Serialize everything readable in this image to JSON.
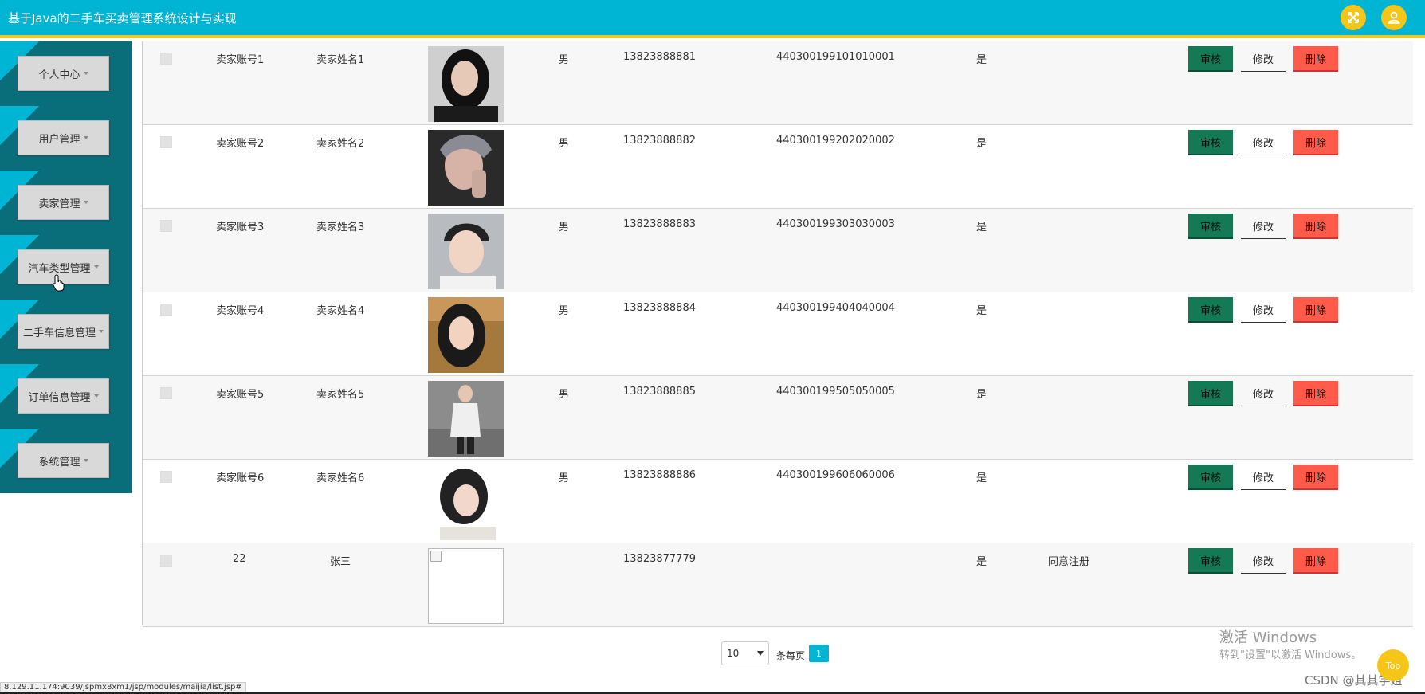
{
  "header": {
    "title": "基于Java的二手车买卖管理系统设计与实现",
    "icons": [
      "fullscreen-icon",
      "user-icon"
    ],
    "accent": "#00b4d4",
    "highlight": "#f5c518"
  },
  "sidebar": {
    "items": [
      {
        "label": "个人中心"
      },
      {
        "label": "用户管理"
      },
      {
        "label": "卖家管理"
      },
      {
        "label": "汽车类型管理"
      },
      {
        "label": "二手车信息管理"
      },
      {
        "label": "订单信息管理"
      },
      {
        "label": "系统管理"
      }
    ]
  },
  "table": {
    "rows": [
      {
        "account": "卖家账号1",
        "name": "卖家姓名1",
        "gender": "男",
        "phone": "13823888881",
        "id_card": "440300199101010001",
        "approved": "是",
        "reply": "",
        "photo": "avatar-1"
      },
      {
        "account": "卖家账号2",
        "name": "卖家姓名2",
        "gender": "男",
        "phone": "13823888882",
        "id_card": "440300199202020002",
        "approved": "是",
        "reply": "",
        "photo": "avatar-2"
      },
      {
        "account": "卖家账号3",
        "name": "卖家姓名3",
        "gender": "男",
        "phone": "13823888883",
        "id_card": "440300199303030003",
        "approved": "是",
        "reply": "",
        "photo": "avatar-3"
      },
      {
        "account": "卖家账号4",
        "name": "卖家姓名4",
        "gender": "男",
        "phone": "13823888884",
        "id_card": "440300199404040004",
        "approved": "是",
        "reply": "",
        "photo": "avatar-4"
      },
      {
        "account": "卖家账号5",
        "name": "卖家姓名5",
        "gender": "男",
        "phone": "13823888885",
        "id_card": "440300199505050005",
        "approved": "是",
        "reply": "",
        "photo": "avatar-5"
      },
      {
        "account": "卖家账号6",
        "name": "卖家姓名6",
        "gender": "男",
        "phone": "13823888886",
        "id_card": "440300199606060006",
        "approved": "是",
        "reply": "",
        "photo": "avatar-6"
      },
      {
        "account": "22",
        "name": "张三",
        "gender": "",
        "phone": "13823877779",
        "id_card": "",
        "approved": "是",
        "reply": "同意注册",
        "photo": "broken-image"
      }
    ],
    "actions": {
      "audit": "审核",
      "edit": "修改",
      "delete": "删除"
    },
    "colors": {
      "audit": "#137a55",
      "delete": "#ff5a4a"
    }
  },
  "pagination": {
    "page_size": "10",
    "per_page_label": "条每页",
    "current_page": "1"
  },
  "overlay": {
    "win_activate_title": "激活 Windows",
    "win_activate_sub": "转到\"设置\"以激活 Windows。",
    "csdn": "CSDN @其其学姐",
    "top": "Top",
    "status_url": "8.129.11.174:9039/jspmx8xm1/jsp/modules/maijia/list.jsp#"
  }
}
